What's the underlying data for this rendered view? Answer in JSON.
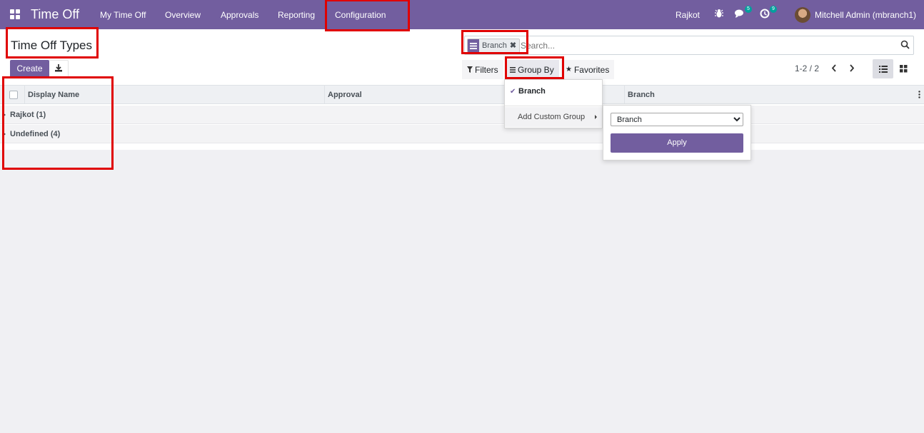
{
  "navbar": {
    "app_name": "Time Off",
    "menu": [
      "My Time Off",
      "Overview",
      "Approvals",
      "Reporting",
      "Configuration"
    ],
    "company": "Rajkot",
    "messages_count": "5",
    "activities_count": "9",
    "user_name": "Mitchell Admin (mbranch1)"
  },
  "page": {
    "title": "Time Off Types",
    "create_label": "Create"
  },
  "search": {
    "facet_value": "Branch",
    "placeholder": "Search...",
    "filters_label": "Filters",
    "group_by_label": "Group By",
    "favorites_label": "Favorites"
  },
  "pager": {
    "value": "1-2 / 2"
  },
  "list": {
    "columns": [
      "Display Name",
      "Approval",
      "Branch"
    ],
    "groups": [
      "Rajkot (1)",
      "Undefined (4)"
    ]
  },
  "group_by_dropdown": {
    "selected_item": "Branch",
    "custom_group_label": "Add Custom Group",
    "custom_group_options": [
      "Branch"
    ],
    "apply_label": "Apply"
  },
  "colors": {
    "brand": "#725e9f",
    "highlight": "#e00000",
    "badge": "#00a09d"
  },
  "icons": [
    "apps-icon",
    "bug-icon",
    "chat-icon",
    "activity-icon",
    "download-icon",
    "search-icon",
    "filter-icon",
    "group-by-icon",
    "star-icon",
    "chevron-left-icon",
    "chevron-right-icon",
    "list-view-icon",
    "kanban-view-icon",
    "kebab-icon",
    "check-icon"
  ]
}
